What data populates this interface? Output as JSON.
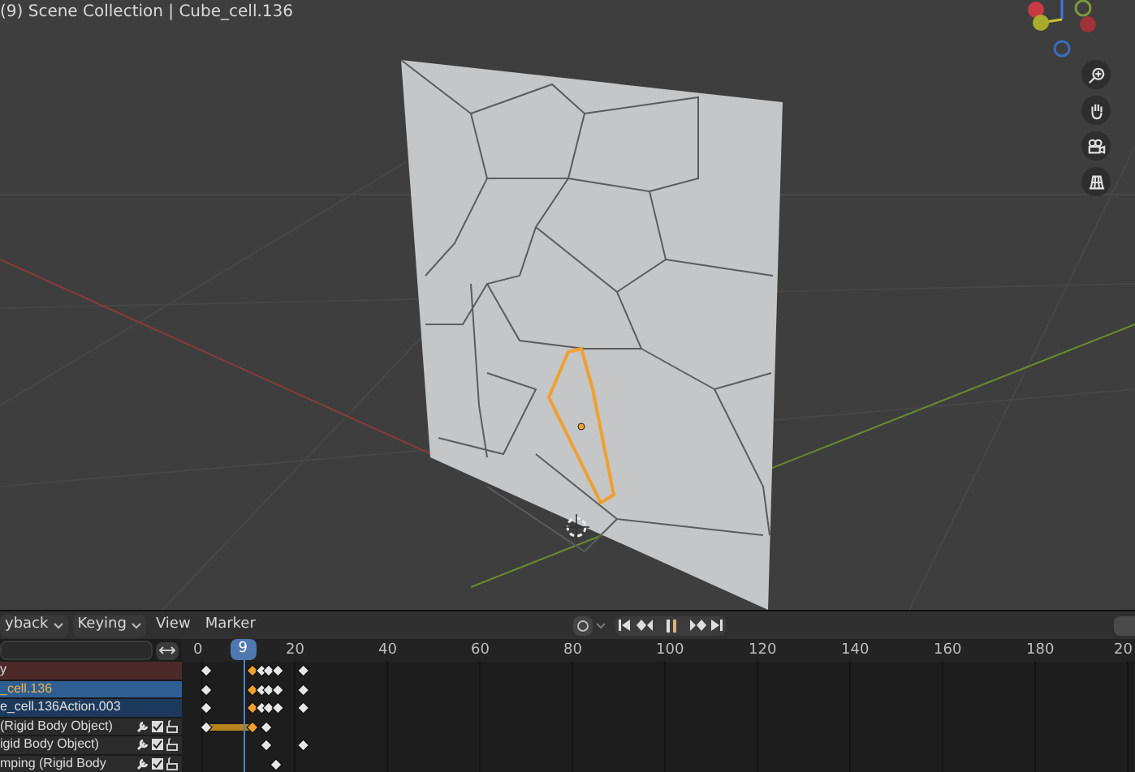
{
  "viewport": {
    "header_text": "(9) Scene Collection | Cube_cell.136"
  },
  "timeline": {
    "menus": [
      {
        "label": "yback",
        "kind": "dropdown"
      },
      {
        "label": "Keying",
        "kind": "dropdown"
      },
      {
        "label": "View",
        "kind": "menu"
      },
      {
        "label": "Marker",
        "kind": "menu"
      }
    ],
    "playing": true,
    "ruler": {
      "ticks": [
        "0",
        "20",
        "40",
        "60",
        "80",
        "100",
        "120",
        "140",
        "160",
        "180",
        "20"
      ],
      "current_frame": "9"
    },
    "channels": [
      {
        "label": "y",
        "kind": "summary"
      },
      {
        "label": "_cell.136",
        "kind": "object"
      },
      {
        "label": "e_cell.136Action.003",
        "kind": "action"
      },
      {
        "label": "(Rigid Body Object)",
        "kind": "property",
        "enabled": true
      },
      {
        "label": "igid Body Object)",
        "kind": "property",
        "enabled": true
      },
      {
        "label": "mping (Rigid Body",
        "kind": "property",
        "enabled": true
      }
    ]
  }
}
